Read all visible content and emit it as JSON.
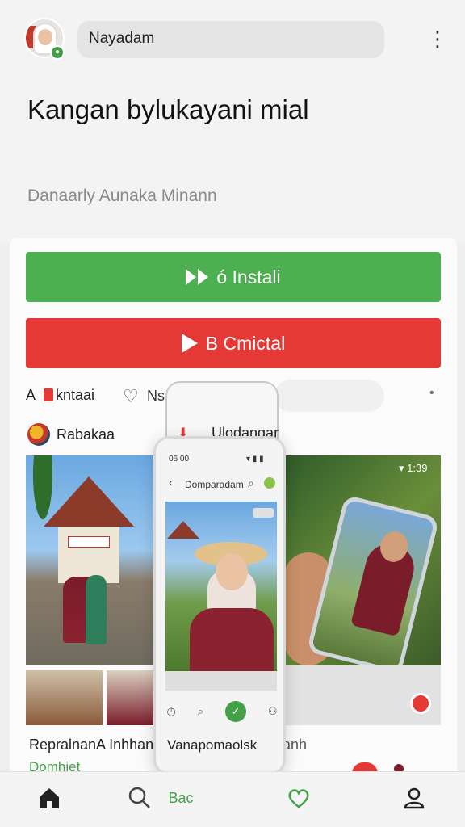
{
  "header": {
    "search_text": "Nayadam",
    "title": "Kangan bylukayani mial",
    "subtitle": "Danaarly Aunaka Minann"
  },
  "buttons": {
    "install_label": "ó Instali",
    "uninstall_label": "B Cmictal"
  },
  "chips": {
    "first_label": "kntaai",
    "second_label": "Ns"
  },
  "account": {
    "name": "Rabakaa",
    "second_name": "Ulodangar"
  },
  "media": {
    "time_label": "1:39"
  },
  "phone": {
    "status_time": "06 00",
    "page_title": "Domparadam",
    "caption": "Vanapomaolsk"
  },
  "captions": {
    "left": "RepralnanA Inhhant",
    "right": "anh",
    "green": "Domhiet"
  },
  "bottom_nav": {
    "middle_label": "Bac"
  },
  "colors": {
    "install_green": "#4caf50",
    "uninstall_red": "#e53935",
    "accent_green": "#43a047"
  }
}
